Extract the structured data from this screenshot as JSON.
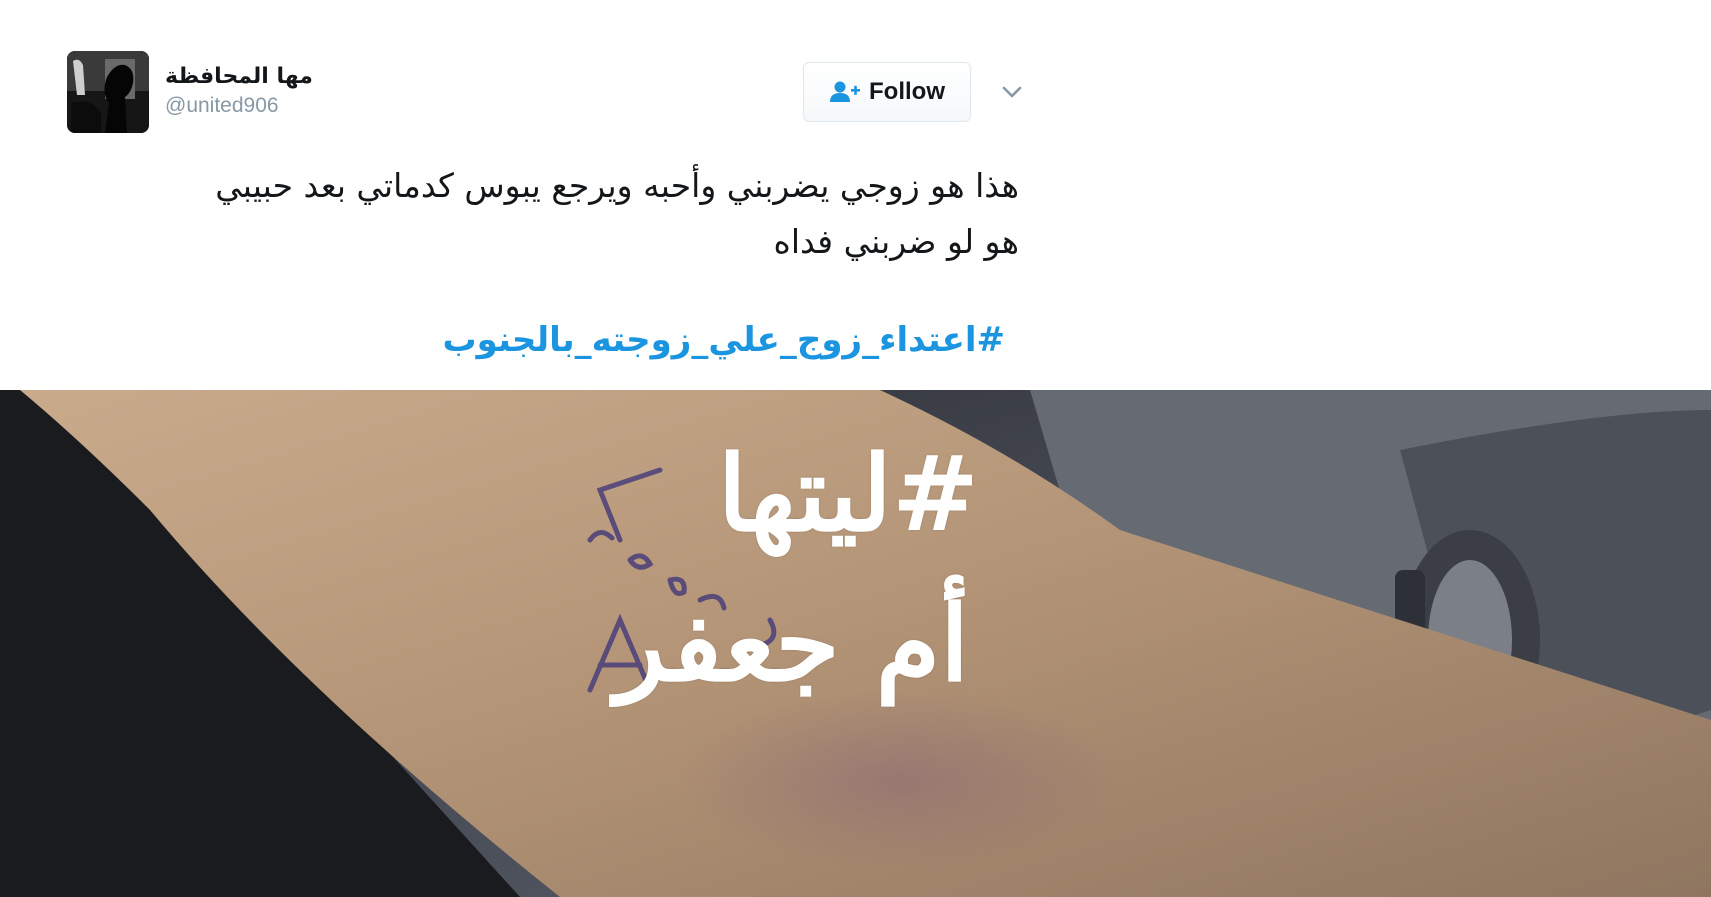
{
  "tweet": {
    "author": {
      "display_name": "مها المحافظة",
      "handle": "@united906"
    },
    "follow_label": "Follow",
    "text_lines": [
      "هذا هو زوجي يضربني وأحبه ويرجع يبوس كدماتي بعد حبيبي",
      "هو لو ضربني فداه"
    ],
    "hashtag": "#اعتداء_زوج_علي_زوجته_بالجنوب"
  },
  "photo": {
    "overlay_line1": "#ليتها",
    "overlay_line2": "أم جعفر",
    "ink_marks": "Leave A"
  },
  "colors": {
    "hashtag_link": "#1b95e0",
    "handle_gray": "#8899a6",
    "follow_icon": "#1b95e0"
  },
  "icons": {
    "follow": "add-user-icon",
    "menu": "chevron-down-icon"
  }
}
